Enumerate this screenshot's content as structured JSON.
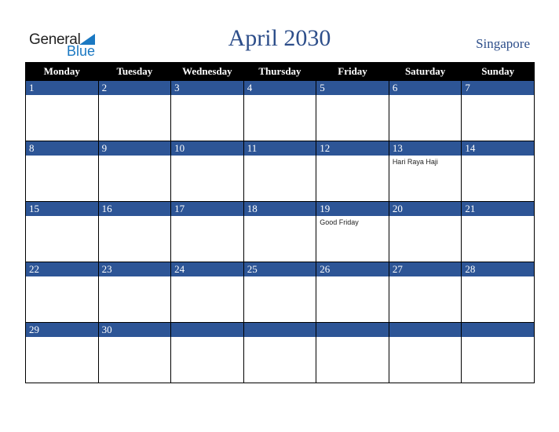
{
  "logo": {
    "word1": "General",
    "word2": "Blue"
  },
  "title": "April 2030",
  "country": "Singapore",
  "colors": {
    "header_bg": "#000000",
    "daybar_bg": "#2d5596",
    "title": "#2d4e8a",
    "logo_blue": "#1a78c2"
  },
  "weekdays": [
    "Monday",
    "Tuesday",
    "Wednesday",
    "Thursday",
    "Friday",
    "Saturday",
    "Sunday"
  ],
  "weeks": [
    [
      {
        "day": "1",
        "holiday": ""
      },
      {
        "day": "2",
        "holiday": ""
      },
      {
        "day": "3",
        "holiday": ""
      },
      {
        "day": "4",
        "holiday": ""
      },
      {
        "day": "5",
        "holiday": ""
      },
      {
        "day": "6",
        "holiday": ""
      },
      {
        "day": "7",
        "holiday": ""
      }
    ],
    [
      {
        "day": "8",
        "holiday": ""
      },
      {
        "day": "9",
        "holiday": ""
      },
      {
        "day": "10",
        "holiday": ""
      },
      {
        "day": "11",
        "holiday": ""
      },
      {
        "day": "12",
        "holiday": ""
      },
      {
        "day": "13",
        "holiday": "Hari Raya Haji"
      },
      {
        "day": "14",
        "holiday": ""
      }
    ],
    [
      {
        "day": "15",
        "holiday": ""
      },
      {
        "day": "16",
        "holiday": ""
      },
      {
        "day": "17",
        "holiday": ""
      },
      {
        "day": "18",
        "holiday": ""
      },
      {
        "day": "19",
        "holiday": "Good Friday"
      },
      {
        "day": "20",
        "holiday": ""
      },
      {
        "day": "21",
        "holiday": ""
      }
    ],
    [
      {
        "day": "22",
        "holiday": ""
      },
      {
        "day": "23",
        "holiday": ""
      },
      {
        "day": "24",
        "holiday": ""
      },
      {
        "day": "25",
        "holiday": ""
      },
      {
        "day": "26",
        "holiday": ""
      },
      {
        "day": "27",
        "holiday": ""
      },
      {
        "day": "28",
        "holiday": ""
      }
    ],
    [
      {
        "day": "29",
        "holiday": ""
      },
      {
        "day": "30",
        "holiday": ""
      },
      {
        "day": "",
        "holiday": ""
      },
      {
        "day": "",
        "holiday": ""
      },
      {
        "day": "",
        "holiday": ""
      },
      {
        "day": "",
        "holiday": ""
      },
      {
        "day": "",
        "holiday": ""
      }
    ]
  ]
}
